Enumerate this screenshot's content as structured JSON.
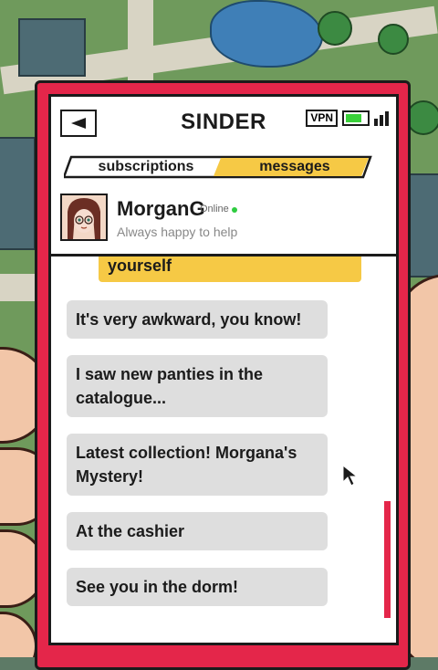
{
  "app": {
    "title": "SINDER"
  },
  "status_bar": {
    "vpn_label": "VPN",
    "battery_level": 0.75,
    "signal_bars": 3
  },
  "tabs": [
    {
      "label": "subscriptions",
      "active": false
    },
    {
      "label": "messages",
      "active": true
    }
  ],
  "profile": {
    "name": "MorganG",
    "status": "Online",
    "tagline": "Always happy to help"
  },
  "messages": [
    {
      "sender": "me",
      "text": "yourself"
    },
    {
      "sender": "contact",
      "text": "It's very awkward, you know!"
    },
    {
      "sender": "contact",
      "text": "I saw new panties in the catalogue..."
    },
    {
      "sender": "contact",
      "text": "Latest collection! Morgana's Mystery!"
    },
    {
      "sender": "contact",
      "text": "At the cashier"
    },
    {
      "sender": "contact",
      "text": "See you in the dorm!"
    }
  ],
  "colors": {
    "phone_frame": "#e4264a",
    "active_tab": "#f6c945",
    "my_bubble": "#f6c945",
    "contact_bubble": "#dedede",
    "online_dot": "#2ecc40"
  }
}
